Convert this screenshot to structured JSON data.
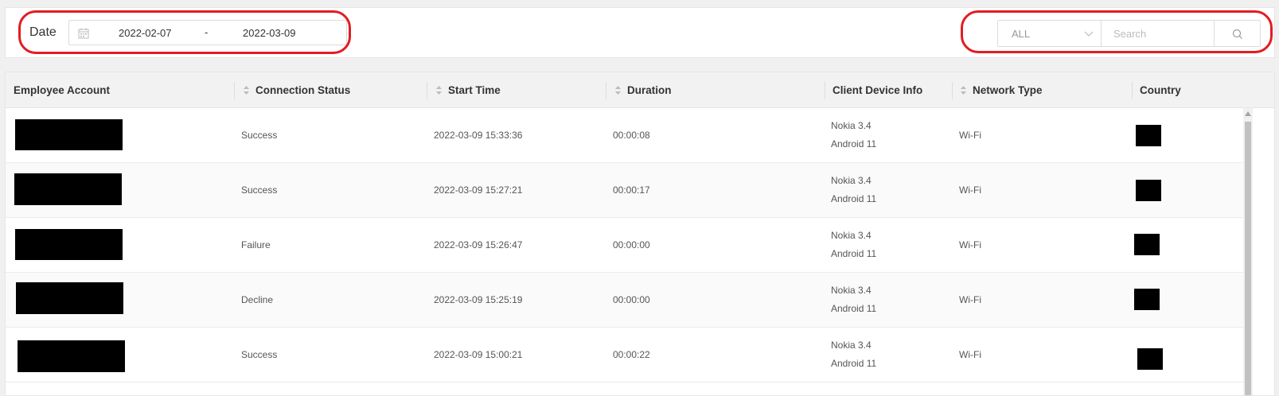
{
  "filters": {
    "date_label": "Date",
    "date_start": "2022-02-07",
    "date_separator": "-",
    "date_end": "2022-03-09",
    "status_select": "ALL",
    "search_placeholder": "Search"
  },
  "table": {
    "columns": [
      "Employee Account",
      "Connection Status",
      "Start Time",
      "Duration",
      "Client Device Info",
      "Network Type",
      "Country"
    ],
    "rows": [
      {
        "status": "Success",
        "start_time": "2022-03-09 15:33:36",
        "duration": "00:00:08",
        "device_model": "Nokia 3.4",
        "device_os": "Android 11",
        "network": "Wi-Fi"
      },
      {
        "status": "Success",
        "start_time": "2022-03-09 15:27:21",
        "duration": "00:00:17",
        "device_model": "Nokia 3.4",
        "device_os": "Android 11",
        "network": "Wi-Fi"
      },
      {
        "status": "Failure",
        "start_time": "2022-03-09 15:26:47",
        "duration": "00:00:00",
        "device_model": "Nokia 3.4",
        "device_os": "Android 11",
        "network": "Wi-Fi"
      },
      {
        "status": "Decline",
        "start_time": "2022-03-09 15:25:19",
        "duration": "00:00:00",
        "device_model": "Nokia 3.4",
        "device_os": "Android 11",
        "network": "Wi-Fi"
      },
      {
        "status": "Success",
        "start_time": "2022-03-09 15:00:21",
        "duration": "00:00:22",
        "device_model": "Nokia 3.4",
        "device_os": "Android 11",
        "network": "Wi-Fi"
      }
    ]
  },
  "colors": {
    "highlight": "#e11d22",
    "header_bg": "#f2f2f2"
  },
  "icons": [
    "calendar-icon",
    "chevron-down-icon",
    "search-icon",
    "sort-icon"
  ]
}
